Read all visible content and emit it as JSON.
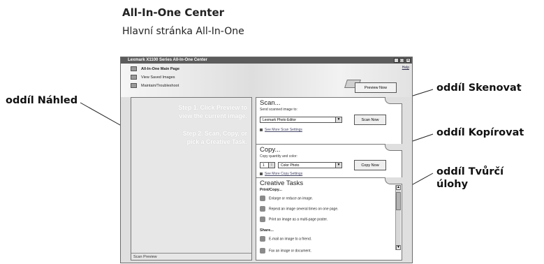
{
  "heading": "All-In-One Center",
  "subheading": "Hlavní stránka All-In-One",
  "callouts": {
    "preview": "oddíl Náhled",
    "scan": "oddíl Skenovat",
    "copy": "oddíl Kopírovat",
    "creative_line1": "oddíl Tvůrčí",
    "creative_line2": "úlohy"
  },
  "window": {
    "title": "Lexmark X1100 Series All-In-One Center",
    "help": "Help",
    "nav": [
      "All-In-One Main Page",
      "View Saved Images",
      "Maintain/Troubleshoot"
    ],
    "preview_button": "Preview Now",
    "preview": {
      "step1_line1": "Step 1.  Click Preview to",
      "step1_line2": "view the current image.",
      "step2_line1": "Step 2.  Scan, Copy, or",
      "step2_line2": "pick a Creative Task.",
      "label": "Scan Preview"
    },
    "scan": {
      "title": "Scan...",
      "sub": "Send scanned image to:",
      "target": "Lexmark Photo Editor",
      "button": "Scan Now",
      "link": "See More Scan Settings"
    },
    "copy": {
      "title": "Copy...",
      "sub": "Copy quantity and color:",
      "quantity": "1",
      "color": "Color Photo",
      "button": "Copy Now",
      "link": "See More Copy Settings"
    },
    "creative": {
      "title": "Creative Tasks",
      "group1": "Print/Copy...",
      "items1": [
        "Enlarge or reduce an image.",
        "Repeat an image several times on one page.",
        "Print an image as a multi-page poster."
      ],
      "group2": "Share...",
      "items2": [
        "E-mail an image to a friend.",
        "Fax an image or document."
      ]
    }
  }
}
